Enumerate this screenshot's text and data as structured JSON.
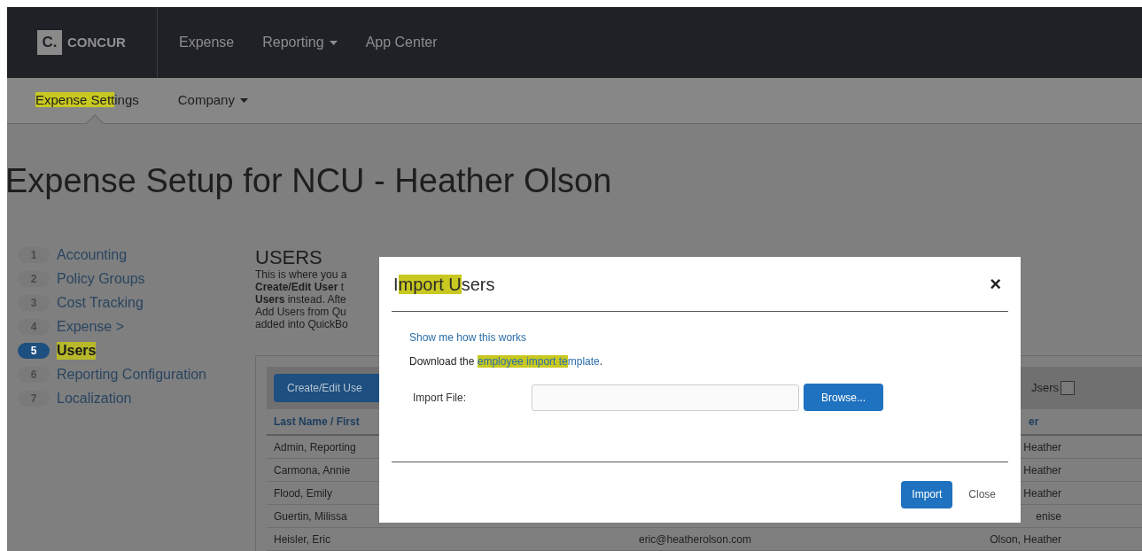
{
  "top_nav": {
    "logo": {
      "mark": "C.",
      "text": "CONCUR"
    },
    "items": [
      {
        "label": "Expense",
        "dropdown": false
      },
      {
        "label": "Reporting",
        "dropdown": true
      },
      {
        "label": "App Center",
        "dropdown": false
      }
    ]
  },
  "sub_nav": {
    "items": [
      {
        "segments": [
          {
            "text": "Expense Sett",
            "highlighted": true
          },
          {
            "text": "ings",
            "highlighted": false
          }
        ],
        "dropdown": false,
        "selected": true
      },
      {
        "segments": [
          {
            "text": "Company",
            "highlighted": false
          }
        ],
        "dropdown": true,
        "selected": false
      }
    ]
  },
  "page_title": "Expense Setup for NCU - Heather Olson",
  "steps": [
    {
      "number": "1",
      "label": "Accounting",
      "selected": false,
      "highlighted": false
    },
    {
      "number": "2",
      "label": "Policy Groups",
      "selected": false,
      "highlighted": false
    },
    {
      "number": "3",
      "label": "Cost Tracking",
      "selected": false,
      "highlighted": false
    },
    {
      "number": "4",
      "label": "Expense >",
      "selected": false,
      "highlighted": false
    },
    {
      "number": "5",
      "label": "Users",
      "selected": true,
      "highlighted": true
    },
    {
      "number": "6",
      "label": "Reporting Configuration",
      "selected": false,
      "highlighted": false
    },
    {
      "number": "7",
      "label": "Localization",
      "selected": false,
      "highlighted": false
    }
  ],
  "users": {
    "heading": "USERS",
    "description_lines": [
      "This is where you a",
      "**Create/Edit User** t",
      "**Users** instead. Afte",
      "Add Users from Qu",
      "added into QuickBo"
    ],
    "toolbar": {
      "button": "Create/Edit Use",
      "checkbox_label": "Jsers",
      "checked": false
    },
    "table": {
      "columns": [
        "Last Name / First",
        "er"
      ],
      "rows": [
        {
          "name": "Admin, Reporting",
          "last_column": "Heather"
        },
        {
          "name": "Carmona, Annie",
          "last_column": "Heather"
        },
        {
          "name": "Flood, Emily",
          "last_column": "Heather"
        },
        {
          "name": "Guertin, Milissa",
          "last_column": "enise"
        },
        {
          "name": "Heisler, Eric",
          "email": "eric@heatherolson.com",
          "last_column": "Olson, Heather"
        }
      ]
    }
  },
  "dialog": {
    "title_segments": [
      {
        "text": "I",
        "highlighted": false
      },
      {
        "text": "mport U",
        "highlighted": true
      },
      {
        "text": "sers",
        "highlighted": false
      }
    ],
    "close": "×",
    "help_link": "Show me how this works",
    "download": {
      "prefix": "Download the ",
      "link_segments": [
        {
          "text": "employee import te",
          "highlighted": true
        },
        {
          "text": "mplate",
          "highlighted": false
        }
      ],
      "suffix": "."
    },
    "file_label": "Import File:",
    "browse": "Browse...",
    "buttons": [
      {
        "label": "Import",
        "kind": "primary"
      },
      {
        "label": "Close",
        "kind": "link"
      }
    ]
  }
}
